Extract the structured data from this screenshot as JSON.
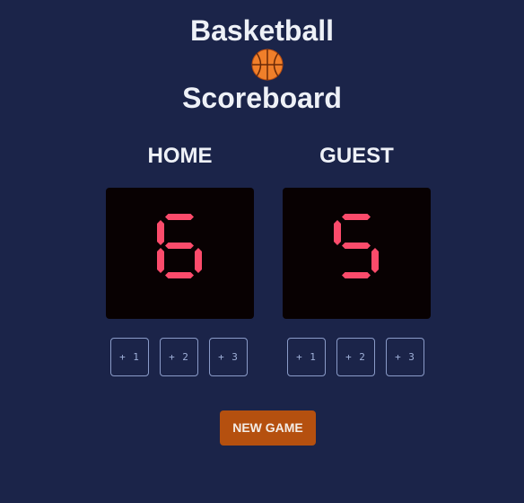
{
  "header": {
    "title_line1": "Basketball",
    "title_line2": "Scoreboard",
    "ball_icon": "basketball-icon"
  },
  "teams": [
    {
      "label": "HOME",
      "score": 6,
      "buttons": [
        "+ 1",
        "+ 2",
        "+ 3"
      ]
    },
    {
      "label": "GUEST",
      "score": 5,
      "buttons": [
        "+ 1",
        "+ 2",
        "+ 3"
      ]
    }
  ],
  "new_game_label": "NEW GAME",
  "colors": {
    "background": "#1b2449",
    "score_digits": "#fb4b6b",
    "score_box": "#080102",
    "new_game_button": "#b5500f"
  }
}
